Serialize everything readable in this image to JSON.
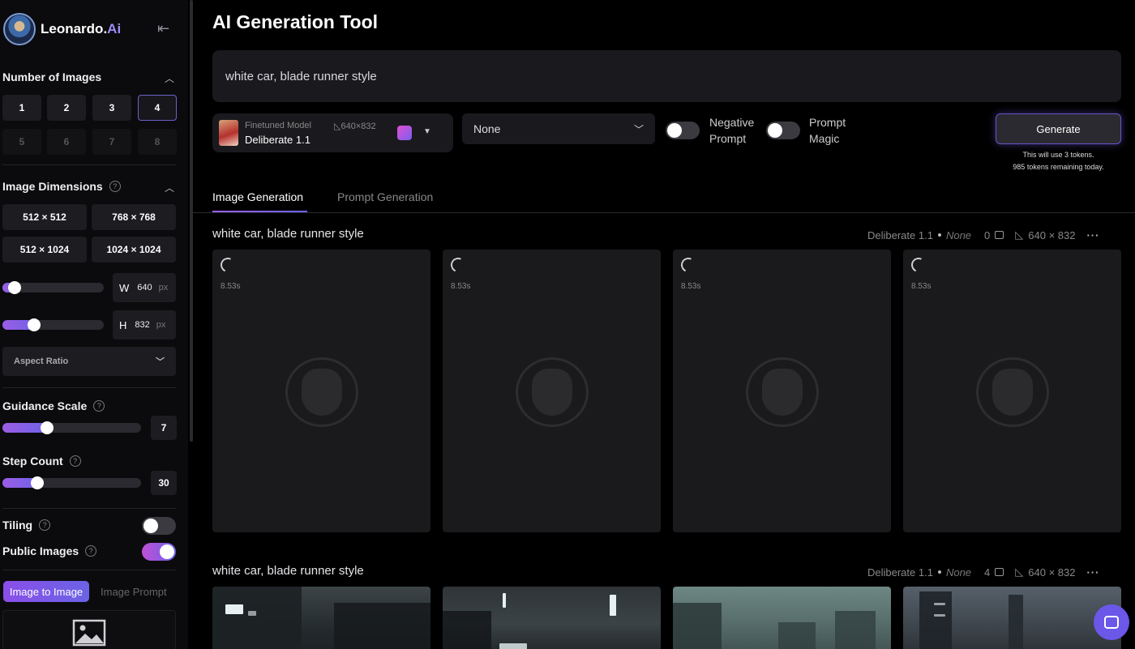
{
  "sidebar": {
    "brand": {
      "name": "Leonardo.",
      "suffix": "Ai"
    },
    "number_of_images": {
      "title": "Number of Images",
      "options": [
        "1",
        "2",
        "3",
        "4",
        "5",
        "6",
        "7",
        "8"
      ],
      "selected": "4"
    },
    "image_dimensions": {
      "title": "Image Dimensions",
      "presets": [
        "512 × 512",
        "768 × 768",
        "512 × 1024",
        "1024 × 1024"
      ],
      "width": {
        "label": "W",
        "value": "640",
        "unit": "px"
      },
      "height": {
        "label": "H",
        "value": "832",
        "unit": "px"
      },
      "aspect_ratio": "Aspect Ratio"
    },
    "guidance_scale": {
      "title": "Guidance Scale",
      "value": "7"
    },
    "step_count": {
      "title": "Step Count",
      "value": "30"
    },
    "tiling": {
      "label": "Tiling",
      "on": false
    },
    "public_images": {
      "label": "Public Images",
      "on": true
    },
    "image_tabs": {
      "active": "Image to Image",
      "inactive": "Image Prompt"
    }
  },
  "main": {
    "title": "AI Generation Tool",
    "prompt": "white car, blade runner style",
    "model": {
      "label": "Finetuned Model",
      "name": "Deliberate 1.1",
      "size": "640×832"
    },
    "style_select": "None",
    "negative_prompt": {
      "line1": "Negative",
      "line2": "Prompt",
      "on": false
    },
    "prompt_magic": {
      "line1": "Prompt",
      "line2": "Magic",
      "on": false
    },
    "generate": {
      "label": "Generate",
      "note1": "This will use 3 tokens.",
      "note2": "985 tokens remaining today."
    },
    "tabs": [
      "Image Generation",
      "Prompt Generation"
    ],
    "generations": [
      {
        "prompt": "white car, blade runner style",
        "model": "Deliberate 1.1",
        "style": "None",
        "count": "0",
        "size": "640 × 832",
        "more": "···",
        "timers": [
          "8.53s",
          "8.53s",
          "8.53s",
          "8.53s"
        ]
      },
      {
        "prompt": "white car, blade runner style",
        "model": "Deliberate 1.1",
        "style": "None",
        "count": "4",
        "size": "640 × 832",
        "more": "···"
      }
    ]
  },
  "colors": {
    "accent_start": "#9b5de5",
    "accent_end": "#6b63e6",
    "background": "#000000",
    "panel": "#1a1a1e"
  },
  "icons": [
    "collapse-icon",
    "help-icon",
    "chevron-up-icon",
    "chevron-down-icon",
    "image-count-icon",
    "size-icon",
    "chat-icon",
    "image-placeholder-icon",
    "spinner-icon"
  ]
}
